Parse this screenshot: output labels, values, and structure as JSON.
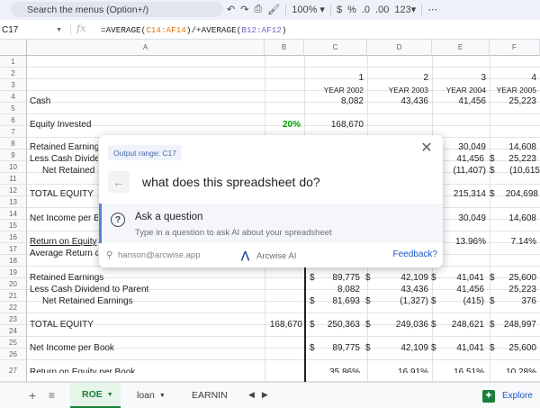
{
  "toolbar": {
    "search_placeholder": "Search the menus (Option+/)",
    "zoom": "100%",
    "currency": "$",
    "percent": "%",
    "dec_decrease": ".0",
    "dec_increase": ".00",
    "number_format": "123"
  },
  "formula_bar": {
    "cell_ref": "C17",
    "fx": "fx",
    "formula_prefix": "=AVERAGE(",
    "range1": "C14:AF14",
    "formula_mid": ")/+AVERAGE(",
    "range2": "B12:AF12",
    "formula_suffix": ")"
  },
  "columns": [
    "A",
    "B",
    "C",
    "D",
    "E",
    "F"
  ],
  "rows": [
    "1",
    "2",
    "3",
    "4",
    "5",
    "6",
    "7",
    "8",
    "9",
    "10",
    "11",
    "12",
    "13",
    "14",
    "15",
    "16",
    "17",
    "18",
    "19",
    "20",
    "21",
    "22",
    "23",
    "24",
    "25",
    "26",
    "27"
  ],
  "cells": {
    "c2": "1",
    "d2": "2",
    "e2": "3",
    "f2": "4",
    "c3": "YEAR 2002",
    "d3": "YEAR 2003",
    "e3": "YEAR 2004",
    "f3": "YEAR 2005",
    "a4": "Cash",
    "c4": "8,082",
    "d4": "43,436",
    "e4": "41,456",
    "f4": "25,223",
    "a6": "Equity Invested",
    "b6": "20%",
    "c6": "168,670",
    "a8": "Retained Earning",
    "e8": "30,049",
    "f8": "14,608",
    "a9": "Less Cash Divide",
    "e9": "41,456",
    "e9d": "$",
    "f9": "25,223",
    "a10": "Net Retained",
    "e10": "(11,407)",
    "e10d": "$",
    "f10": "(10,615",
    "a12": "TOTAL EQUITY",
    "e12": "215,314",
    "e12d": "$",
    "f12": "204,698",
    "a14": "Net Income per B",
    "e14": "30,049",
    "f14": "14,608",
    "a16": "Return on Equity",
    "e16": "13.96%",
    "f16": "7.14%",
    "a17": "Average Return c",
    "a19": "Retained Earnings",
    "c19d": "$",
    "c19": "89,775",
    "c19s": "$",
    "d19": "42,109",
    "d19s": "$",
    "e19": "41,041",
    "e19s": "$",
    "f19": "25,600",
    "a20": "Less Cash Dividend to Parent",
    "c20": "8,082",
    "d20": "43,436",
    "e20": "41,456",
    "f20": "25,223",
    "a21": "Net Retained Earnings",
    "c21d": "$",
    "c21": "81,693",
    "c21s": "$",
    "d21": "(1,327)",
    "d21s": "$",
    "e21": "(415)",
    "e21s": "$",
    "f21": "376",
    "a23": "TOTAL EQUITY",
    "b23": "168,670",
    "c23d": "$",
    "c23": "250,363",
    "c23s": "$",
    "d23": "249,036",
    "d23s": "$",
    "e23": "248,621",
    "e23s": "$",
    "f23": "248,997",
    "a25": "Net Income per Book",
    "c25d": "$",
    "c25": "89,775",
    "c25s": "$",
    "d25": "42,109",
    "d25s": "$",
    "e25": "41,041",
    "e25s": "$",
    "f25": "25,600",
    "a27": "Return on Equity per Book",
    "c27": "35.86%",
    "d27": "16.91%",
    "e27": "16.51%",
    "f27": "10.28%"
  },
  "dialog": {
    "output_range": "Output range: C17",
    "close": "✕",
    "back": "←",
    "query": "what does this spreadsheet do?",
    "suggest_title": "Ask a question",
    "suggest_sub": "Type in a question to ask AI about your spreadsheet",
    "user_email": "hanson@arcwise.app",
    "brand": "Arcwise AI",
    "feedback": "Feedback?"
  },
  "tabs": {
    "add": "+",
    "list": "≡",
    "sheets": [
      "ROE",
      "loan",
      "EARNIN"
    ],
    "explore": "Explore"
  },
  "colors": {
    "accent": "#188038",
    "highlight_pct": "#00a000",
    "link": "#1a56c9"
  }
}
